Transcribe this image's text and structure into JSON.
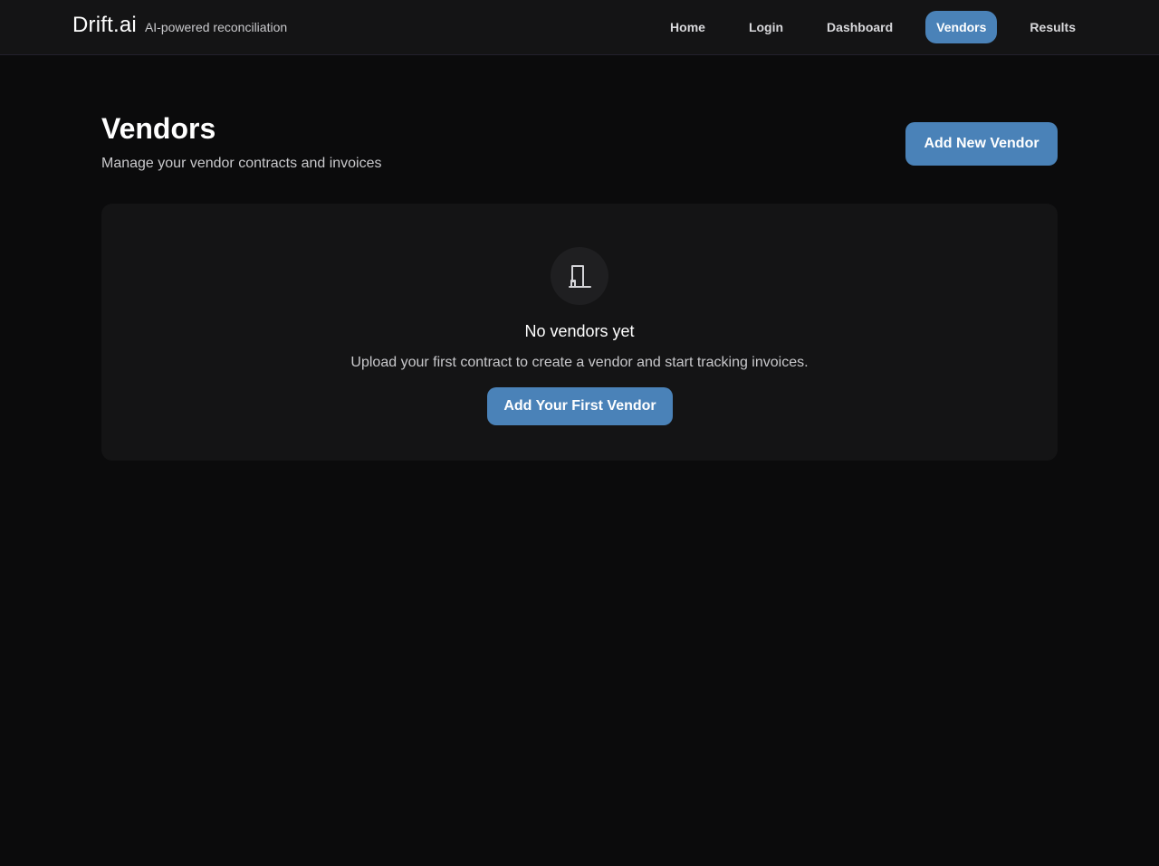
{
  "brand": {
    "name": "Drift.ai",
    "tagline": "AI-powered reconciliation"
  },
  "nav": {
    "items": [
      {
        "label": "Home",
        "active": false
      },
      {
        "label": "Login",
        "active": false
      },
      {
        "label": "Dashboard",
        "active": false
      },
      {
        "label": "Vendors",
        "active": true
      },
      {
        "label": "Results",
        "active": false
      }
    ]
  },
  "page": {
    "title": "Vendors",
    "subtitle": "Manage your vendor contracts and invoices",
    "add_button_label": "Add New Vendor"
  },
  "empty_state": {
    "icon": "building-icon",
    "title": "No vendors yet",
    "description": "Upload your first contract to create a vendor and start tracking invoices.",
    "button_label": "Add Your First Vendor"
  },
  "colors": {
    "background": "#0b0b0c",
    "surface": "#141415",
    "accent": "#4a82b8",
    "text_muted": "#c9c9cc"
  }
}
